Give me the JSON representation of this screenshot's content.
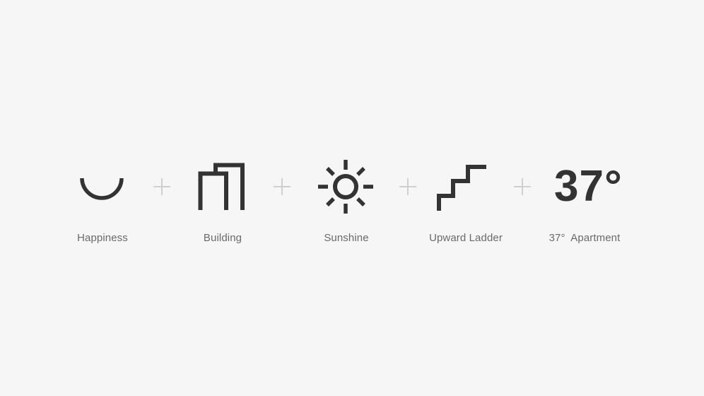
{
  "colors": {
    "background": "#f6f6f6",
    "icon": "#333333",
    "plus": "#cfcfcf",
    "label": "#6a6a6a"
  },
  "items": [
    {
      "icon": "smile-arc-icon",
      "label": "Happiness"
    },
    {
      "icon": "building-icon",
      "label": "Building"
    },
    {
      "icon": "sun-icon",
      "label": "Sunshine"
    },
    {
      "icon": "stairs-icon",
      "label": "Upward Ladder"
    },
    {
      "icon": "temperature-text",
      "label": "37°  Apartment",
      "value": "37°"
    }
  ],
  "operator": "+"
}
